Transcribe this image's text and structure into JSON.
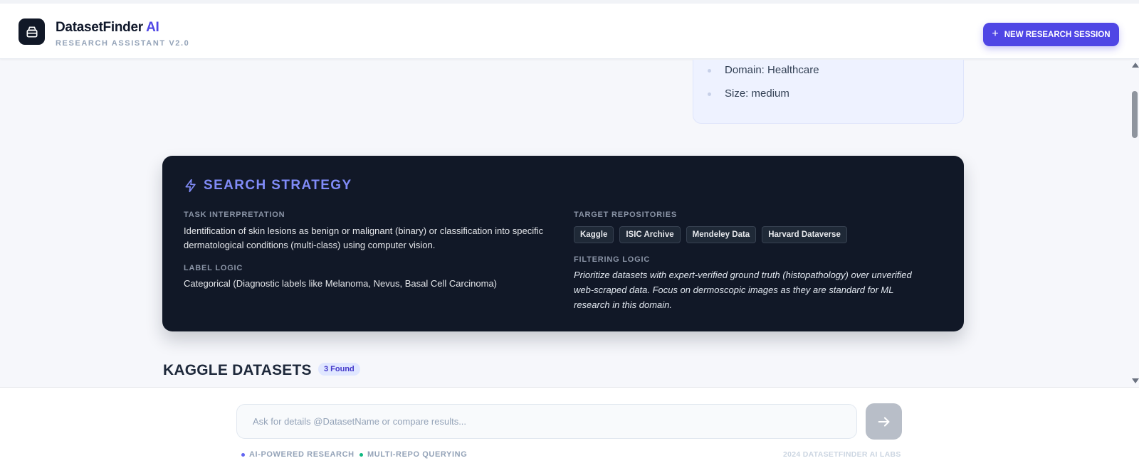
{
  "header": {
    "brand_name": "DatasetFinder",
    "brand_suffix": "AI",
    "tagline": "RESEARCH ASSISTANT V2.0",
    "new_session_label": "NEW RESEARCH SESSION",
    "logo_icon": "archive-icon",
    "accent_color": "#4f46e5"
  },
  "summary": {
    "items": [
      "Domain: Healthcare",
      "Size: medium"
    ]
  },
  "strategy": {
    "title": "SEARCH STRATEGY",
    "icon": "bolt-icon",
    "task_label": "TASK INTERPRETATION",
    "task_text": "Identification of skin lesions as benign or malignant (binary) or classification into specific dermatological conditions (multi-class) using computer vision.",
    "label_logic_label": "LABEL LOGIC",
    "label_logic_text": "Categorical (Diagnostic labels like Melanoma, Nevus, Basal Cell Carcinoma)",
    "repos_label": "TARGET REPOSITORIES",
    "repos": [
      "Kaggle",
      "ISIC Archive",
      "Mendeley Data",
      "Harvard Dataverse"
    ],
    "filter_label": "FILTERING LOGIC",
    "filter_text": "Prioritize datasets with expert-verified ground truth (histopathology) over unverified web-scraped data. Focus on dermoscopic images as they are standard for ML research in this domain."
  },
  "kaggle": {
    "title": "KAGGLE DATASETS",
    "found": "3 Found"
  },
  "footer": {
    "chat_placeholder": "Ask for details @DatasetName or compare results...",
    "send_icon": "arrow-right-icon",
    "badge_research": "AI-POWERED RESEARCH",
    "badge_multi": "MULTI-REPO QUERYING",
    "copyright": "2024 DATASETFINDER AI LABS"
  }
}
